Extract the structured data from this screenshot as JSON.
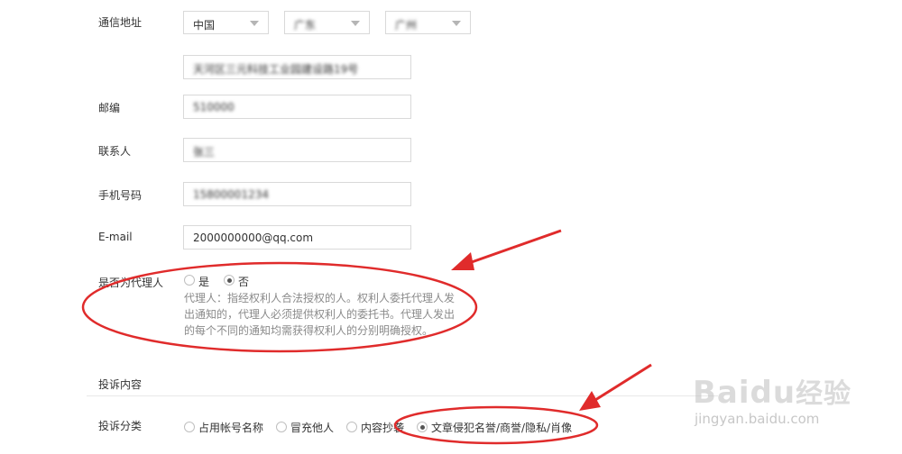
{
  "address": {
    "label": "通信地址",
    "country": "中国",
    "province": "广东",
    "city": "广州",
    "street": "天河区三元科技工业园建设路19号"
  },
  "postcode": {
    "label": "邮编",
    "value": "510000"
  },
  "contact": {
    "label": "联系人",
    "value": "张三"
  },
  "phone": {
    "label": "手机号码",
    "value": "15800001234"
  },
  "email": {
    "label": "E-mail",
    "value": "2000000000@qq.com"
  },
  "agent": {
    "label": "是否为代理人",
    "options": [
      "是",
      "否"
    ],
    "selected": "否",
    "note": "代理人：指经权利人合法授权的人。权利人委托代理人发出通知的，代理人必须提供权利人的委托书。代理人发出的每个不同的通知均需获得权利人的分别明确授权。"
  },
  "complaint": {
    "section_title": "投诉内容",
    "category_label": "投诉分类",
    "options": [
      "占用帐号名称",
      "冒充他人",
      "内容抄袭",
      "文章侵犯名誉/商誉/隐私/肖像"
    ],
    "selected": "文章侵犯名誉/商誉/隐私/肖像"
  },
  "annotations": {
    "color": "#e02b2b"
  },
  "watermark": {
    "brand": "Baidu",
    "product": "经验",
    "url": "jingyan.baidu.com"
  }
}
